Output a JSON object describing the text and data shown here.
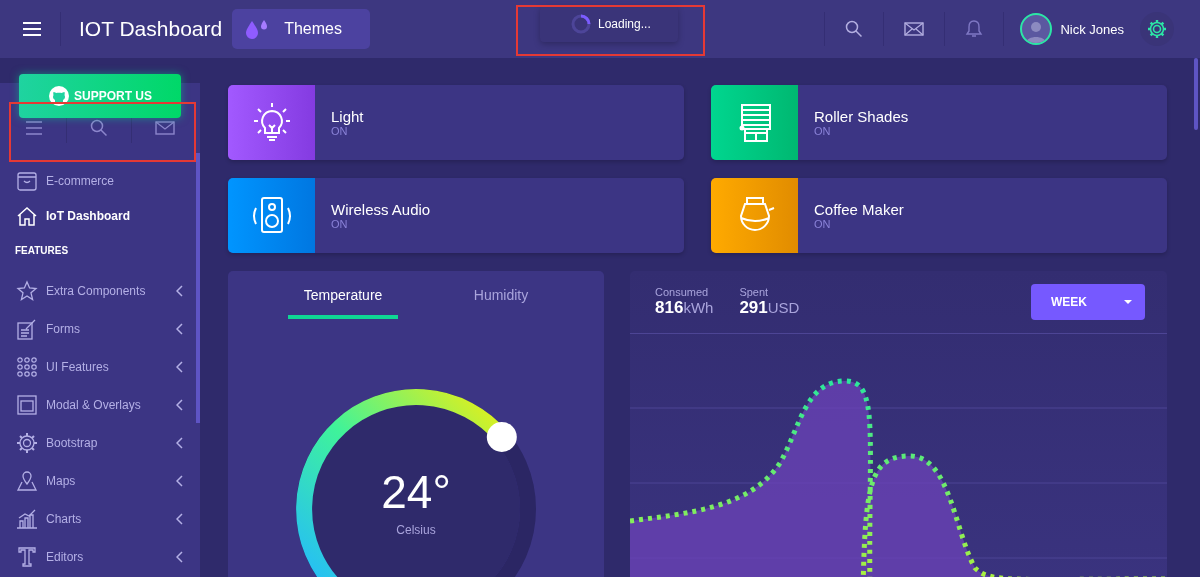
{
  "header": {
    "title": "IOT Dashboard",
    "theme_button": "Themes",
    "loading": "Loading...",
    "user": "Nick Jones"
  },
  "sidebar": {
    "support_button": "SUPPORT US",
    "items": [
      {
        "label": "E-commerce",
        "selected": false,
        "expandable": false
      },
      {
        "label": "IoT Dashboard",
        "selected": true,
        "expandable": false
      }
    ],
    "section": "FEATURES",
    "feature_items": [
      {
        "label": "Extra Components",
        "selected": false,
        "expandable": true
      },
      {
        "label": "Forms",
        "selected": false,
        "expandable": true
      },
      {
        "label": "UI Features",
        "selected": false,
        "expandable": true
      },
      {
        "label": "Modal & Overlays",
        "selected": false,
        "expandable": true
      },
      {
        "label": "Bootstrap",
        "selected": false,
        "expandable": true
      },
      {
        "label": "Maps",
        "selected": false,
        "expandable": true
      },
      {
        "label": "Charts",
        "selected": false,
        "expandable": true
      },
      {
        "label": "Editors",
        "selected": false,
        "expandable": true
      }
    ]
  },
  "devices": [
    {
      "name": "Light",
      "status": "ON",
      "color": "#a259ff"
    },
    {
      "name": "Roller Shades",
      "status": "ON",
      "color": "#00d68f"
    },
    {
      "name": "Wireless Audio",
      "status": "ON",
      "color": "#0095ff"
    },
    {
      "name": "Coffee Maker",
      "status": "ON",
      "color": "#ffaa00"
    }
  ],
  "temperature": {
    "tabs": [
      {
        "label": "Temperature",
        "selected": true
      },
      {
        "label": "Humidity",
        "selected": false
      }
    ],
    "value": "24°",
    "unit": "Celsius"
  },
  "electricity": {
    "stats": [
      {
        "label": "Consumed",
        "value": "816",
        "unit": "kWh"
      },
      {
        "label": "Spent",
        "value": "291",
        "unit": "USD"
      }
    ],
    "period": "WEEK"
  }
}
